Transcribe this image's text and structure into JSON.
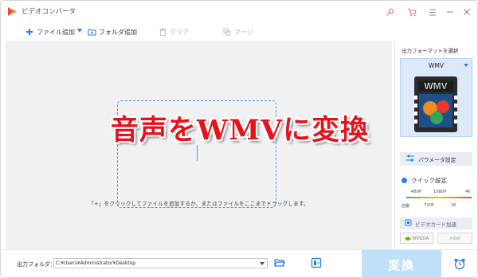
{
  "window": {
    "title": "ビデオコンバータ",
    "accent_color": "#2a7ee0",
    "icons": [
      "app-logo-icon",
      "key-icon",
      "cart-icon",
      "menu-icon",
      "minimize-icon",
      "close-icon"
    ]
  },
  "toolbar": {
    "add_file": "ファイル追加",
    "add_folder": "フォルダ追加",
    "clear": "クリア",
    "merge": "マージ"
  },
  "main": {
    "hint": "「+」をクリックしてファイルを追加するか、またはファイルをここまでドラッグします。",
    "headline": "音声をWMVに変換"
  },
  "right_panel": {
    "title": "出力フォーマットを選択",
    "format": "WMV",
    "format_badge": "WMV",
    "param_button": "パラメータ設定",
    "quick_settings": "クイック設定",
    "quality_top": [
      "480P",
      "1080P",
      "4K"
    ],
    "quality_bottom": [
      "自動",
      "720P",
      "2K"
    ],
    "gpu_button": "ビデオカード加速",
    "nvidia": "NVIDIA",
    "intel": "Intel"
  },
  "bottom": {
    "output_label": "出力フォルダ：",
    "output_path": "C:¥Users¥Administrator¥Desktop",
    "convert": "変換"
  }
}
